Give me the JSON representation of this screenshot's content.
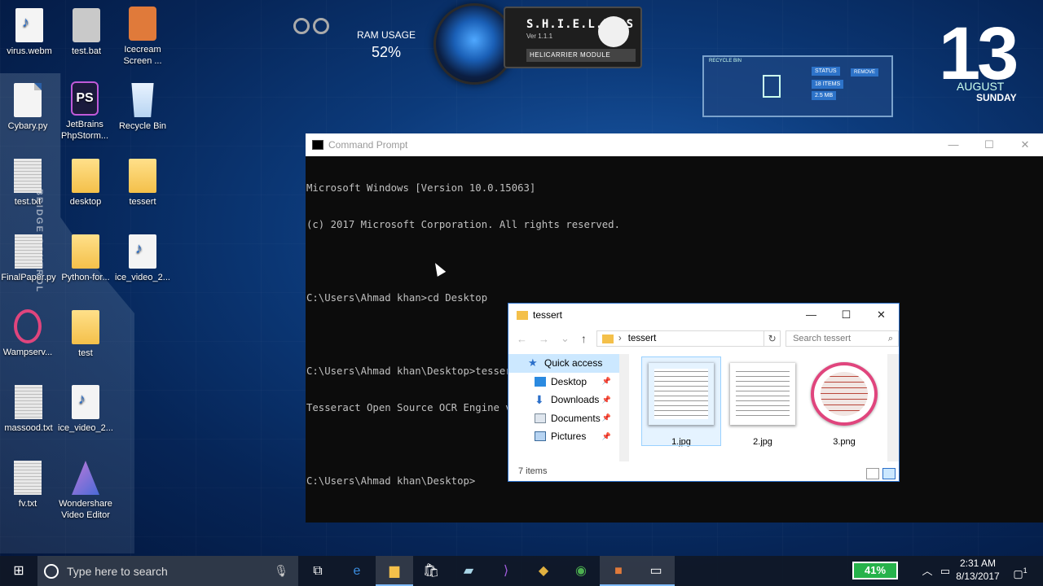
{
  "desktop_icons": [
    {
      "label": "virus.webm"
    },
    {
      "label": "test.bat"
    },
    {
      "label": "Icecream Screen ..."
    },
    {
      "label": "Cybary.py"
    },
    {
      "label": "JetBrains PhpStorm..."
    },
    {
      "label": "Recycle Bin"
    },
    {
      "label": "test.txt"
    },
    {
      "label": "desktop"
    },
    {
      "label": "tessert"
    },
    {
      "label": "FinalPaper.py"
    },
    {
      "label": "Python-for..."
    },
    {
      "label": "ice_video_2..."
    },
    {
      "label": "Wampserv..."
    },
    {
      "label": "test"
    },
    {
      "label": "massood.txt"
    },
    {
      "label": "ice_video_2..."
    },
    {
      "label": "fv.txt"
    },
    {
      "label": "Wondershare Video Editor"
    }
  ],
  "widgets": {
    "bridge_control": "BRIDGE CONTROL",
    "ram_title": "RAM USAGE",
    "ram_value": "52%",
    "ram_level": 0.52,
    "shield_name": "S.H.I.E.L.D OS",
    "shield_version": "Ver 1.1.1",
    "shield_module": "HELICARRIER MODULE",
    "recycle_title": "RECYCLE BIN",
    "recycle_status": "STATUS",
    "recycle_items": "18 ITEMS",
    "recycle_size": "2.5 MB",
    "recycle_remove": "REMOVE",
    "clock_day": "13",
    "clock_month": "AUGUST",
    "clock_weekday": "SUNDAY"
  },
  "cmd": {
    "title": "Command Prompt",
    "lines": [
      "Microsoft Windows [Version 10.0.15063]",
      "(c) 2017 Microsoft Corporation. All rights reserved.",
      "",
      "C:\\Users\\Ahmad khan>cd Desktop",
      "",
      "C:\\Users\\Ahmad khan\\Desktop>tesseract tessert\\1.jpg tessert\\outputpdf pdf",
      "Tesseract Open Source OCR Engine v4.00.00alpha with Leptonica",
      "",
      "C:\\Users\\Ahmad khan\\Desktop>"
    ]
  },
  "explorer": {
    "title": "tessert",
    "path": "tessert",
    "search_placeholder": "Search tessert",
    "nav_items": [
      {
        "label": "Quick access",
        "color": "#2b6fc9"
      },
      {
        "label": "Desktop",
        "color": "#2b8ae0"
      },
      {
        "label": "Downloads",
        "color": "#2b6fc9"
      },
      {
        "label": "Documents",
        "color": "#7a8a99"
      },
      {
        "label": "Pictures",
        "color": "#3a6a9a"
      }
    ],
    "files": [
      {
        "name": "1.jpg"
      },
      {
        "name": "2.jpg"
      },
      {
        "name": "3.png"
      }
    ],
    "status": "7 items"
  },
  "taskbar": {
    "search_placeholder": "Type here to search",
    "battery": "41%",
    "battery_level": 0.41,
    "time": "2:31 AM",
    "date": "8/13/2017",
    "notifications": "1"
  }
}
